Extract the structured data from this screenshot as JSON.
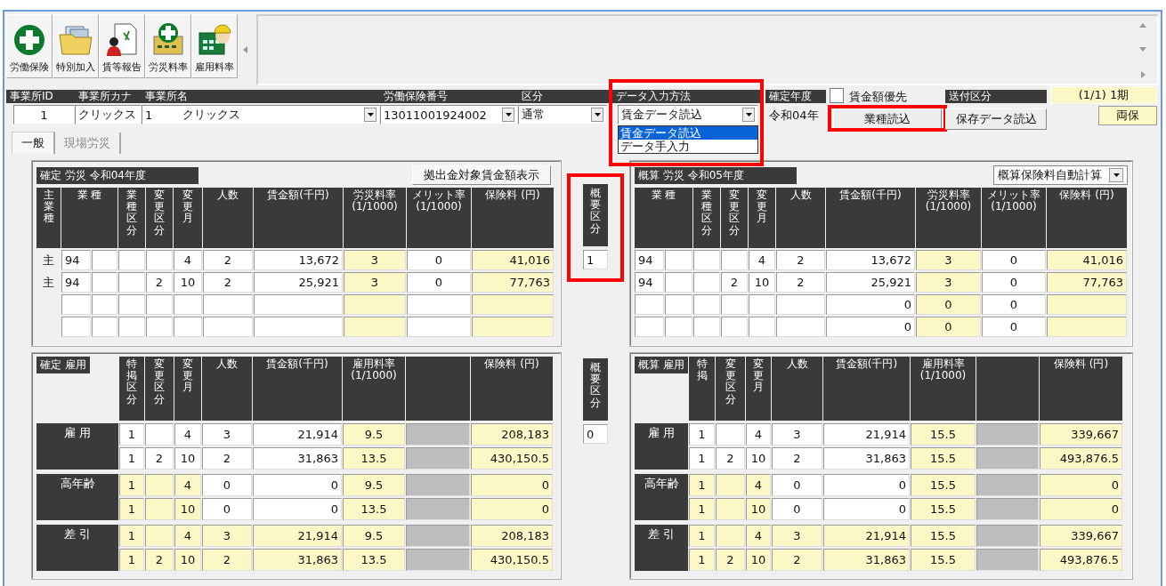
{
  "toolbar": [
    {
      "label": "労働保険"
    },
    {
      "label": "特別加入"
    },
    {
      "label": "賃等報告"
    },
    {
      "label": "労災料率"
    },
    {
      "label": "雇用料率"
    }
  ],
  "header": {
    "office_id": {
      "label": "事業所ID",
      "value": "1"
    },
    "office_kana": {
      "label": "事業所カナ",
      "value": "クリックス"
    },
    "office_name": {
      "label": "事業所名",
      "code": "1",
      "value": "クリックス"
    },
    "insurance_number": {
      "label": "労働保険番号",
      "value": "13011001924002"
    },
    "category": {
      "label": "区分",
      "value": "通常"
    },
    "input_method": {
      "label": "データ入力方法",
      "value": "賃金データ読込",
      "highlighted": true,
      "options": [
        {
          "label": "賃金データ読込",
          "selected": true
        },
        {
          "label": "データ手入力",
          "selected": false
        }
      ]
    },
    "fiscal_year": {
      "label": "確定年度",
      "value": "令和04年"
    },
    "wage_priority": {
      "label": "賃金額優先",
      "checked": false
    },
    "load_industry_button": {
      "label": "業種読込",
      "highlighted": true
    },
    "send_category": {
      "label": "送付区分"
    },
    "load_saved_button": {
      "label": "保存データ読込"
    },
    "period": "(1/1) 1期",
    "insurance_type": "両保"
  },
  "tabs": [
    {
      "label": "一般",
      "selected": true
    },
    {
      "label": "現場労災",
      "selected": false
    }
  ],
  "labor": {
    "confirmed": {
      "title": "確定 労災 令和04年度",
      "button": "拠出金対象賃金額表示",
      "columns": [
        {
          "label": "主業種",
          "kind": "flag"
        },
        {
          "label": "業 種",
          "kind": "code"
        },
        {
          "label": "業種区分",
          "kind": "field"
        },
        {
          "label": "変更区分",
          "kind": "field"
        },
        {
          "label": "変更月",
          "kind": "field"
        },
        {
          "label": "人数",
          "kind": "field"
        },
        {
          "label": "賃金額(千円)",
          "kind": "money"
        },
        {
          "label": "労災料率",
          "unit": "(1/1000)",
          "kind": "calc"
        },
        {
          "label": "メリット率",
          "unit": "(1/1000)",
          "kind": "field"
        },
        {
          "label": "保険料 (円)",
          "kind": "total"
        }
      ],
      "rows": [
        [
          "主",
          "94",
          null,
          null,
          "4",
          "2",
          "13,672",
          "3",
          "0",
          "41,016"
        ],
        [
          "主",
          "94",
          null,
          "2",
          "10",
          "2",
          "25,921",
          "3",
          "0",
          "77,763"
        ],
        [
          null,
          null,
          null,
          null,
          null,
          null,
          null,
          null,
          null,
          null
        ],
        [
          null,
          null,
          null,
          null,
          null,
          null,
          null,
          null,
          null,
          null
        ]
      ]
    },
    "change_category": {
      "label": "概要区分",
      "value": "1",
      "highlighted": true
    },
    "estimate": {
      "title": "概算 労災 令和05年度",
      "dropdown": "概算保険料自動計算",
      "columns": [
        {
          "label": "業 種",
          "kind": "code"
        },
        {
          "label": "業種区分",
          "kind": "field"
        },
        {
          "label": "変更区分",
          "kind": "field"
        },
        {
          "label": "変更月",
          "kind": "field"
        },
        {
          "label": "人数",
          "kind": "field"
        },
        {
          "label": "賃金額(千円)",
          "kind": "money"
        },
        {
          "label": "労災料率",
          "unit": "(1/1000)",
          "kind": "calc"
        },
        {
          "label": "メリット率",
          "unit": "(1/1000)",
          "kind": "field"
        },
        {
          "label": "保険料 (円)",
          "kind": "total"
        }
      ],
      "rows": [
        [
          "94",
          null,
          null,
          "4",
          "2",
          "13,672",
          "3",
          "0",
          "41,016"
        ],
        [
          "94",
          null,
          "2",
          "10",
          "2",
          "25,921",
          "3",
          "0",
          "77,763"
        ],
        [
          null,
          null,
          null,
          null,
          null,
          "0",
          "0",
          "0",
          null
        ],
        [
          null,
          null,
          null,
          null,
          null,
          "0",
          "0",
          "0",
          null
        ]
      ]
    }
  },
  "employment": {
    "confirmed": {
      "title": "確定 雇用",
      "columns": [
        {
          "label": "特掲区分",
          "kind": "field"
        },
        {
          "label": "変更区分",
          "kind": "field"
        },
        {
          "label": "変更月",
          "kind": "field"
        },
        {
          "label": "人数",
          "kind": "field"
        },
        {
          "label": "賃金額(千円)",
          "kind": "money"
        },
        {
          "label": "雇用料率",
          "unit": "(1/1000)",
          "kind": "calc"
        },
        {
          "kind": "filler"
        },
        {
          "label": "保険料 (円)",
          "kind": "total"
        }
      ],
      "groups": [
        {
          "label": "雇 用",
          "kind": "entry",
          "rows": [
            [
              "1",
              null,
              "4",
              "3",
              "21,914",
              "9.5",
              null,
              "208,183"
            ],
            [
              "1",
              "2",
              "10",
              "2",
              "31,863",
              "13.5",
              null,
              "430,150.5"
            ]
          ]
        },
        {
          "label": "高年齢",
          "kind": "fixed",
          "rows": [
            [
              "1",
              null,
              "4",
              "0",
              "0",
              "9.5",
              null,
              "0"
            ],
            [
              "1",
              null,
              "10",
              "0",
              "0",
              "13.5",
              null,
              "0"
            ]
          ]
        },
        {
          "label": "差 引",
          "kind": "total",
          "rows": [
            [
              "1",
              null,
              "4",
              "3",
              "21,914",
              "9.5",
              null,
              "208,183"
            ],
            [
              "1",
              "2",
              "10",
              "2",
              "31,863",
              "13.5",
              null,
              "430,150.5"
            ]
          ]
        }
      ]
    },
    "change_category": {
      "label": "概要区分",
      "value": "0",
      "highlighted": false
    },
    "estimate": {
      "title": "概算 雇用",
      "columns": [
        {
          "label": "特掲",
          "kind": "field"
        },
        {
          "label": "変更区分",
          "kind": "field"
        },
        {
          "label": "変更月",
          "kind": "field"
        },
        {
          "label": "人数",
          "kind": "field"
        },
        {
          "label": "賃金額(千円)",
          "kind": "money"
        },
        {
          "label": "雇用料率",
          "unit": "(1/1000)",
          "kind": "calc"
        },
        {
          "kind": "filler"
        },
        {
          "label": "保険料 (円)",
          "kind": "total"
        }
      ],
      "groups": [
        {
          "label": "雇 用",
          "kind": "entry",
          "rows": [
            [
              "1",
              null,
              "4",
              "3",
              "21,914",
              "15.5",
              null,
              "339,667"
            ],
            [
              "1",
              "2",
              "10",
              "2",
              "31,863",
              "15.5",
              null,
              "493,876.5"
            ]
          ]
        },
        {
          "label": "高年齢",
          "kind": "fixed",
          "rows": [
            [
              "1",
              null,
              "4",
              "0",
              "0",
              "15.5",
              null,
              "0"
            ],
            [
              "1",
              null,
              "10",
              "0",
              "0",
              "15.5",
              null,
              "0"
            ]
          ]
        },
        {
          "label": "差 引",
          "kind": "total",
          "rows": [
            [
              "1",
              null,
              "4",
              "3",
              "21,914",
              "15.5",
              null,
              "339,667"
            ],
            [
              "1",
              "2",
              "10",
              "2",
              "31,863",
              "15.5",
              null,
              "493,876.5"
            ]
          ]
        }
      ]
    }
  }
}
